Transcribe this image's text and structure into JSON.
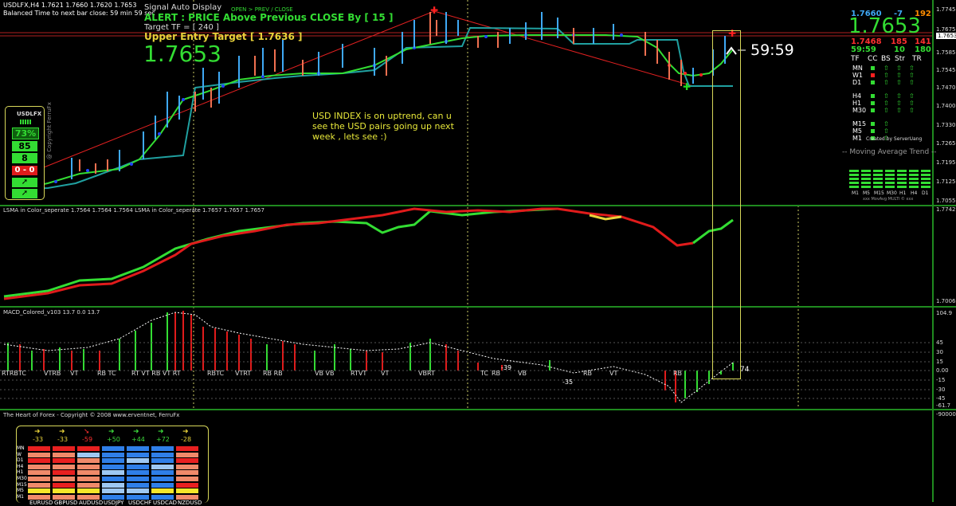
{
  "symbol_header": {
    "line1": "USDLFX,H4  1.7621 1.7660 1.7620 1.7653",
    "line2": "Balanced Time to next bar close: 59 min 59 sec"
  },
  "signal": {
    "title": "Signal Auto Display",
    "subtitle": "OPEN > PREV / CLOSE",
    "alert": "ALERT : PRICE Above Previous CLOSE By [ 15 ]",
    "target_tf": "Target TF = [ 240 ]",
    "upper_entry": "Upper Entry Target [ 1.7636 ]",
    "price": "1.7653"
  },
  "annotation": "USD INDEX is on uptrend, can u see the USD pairs going up next week , lets see :)",
  "countdown": "59:59",
  "left_widget": {
    "title": "USDLFX",
    "percent": "73%",
    "strength": "85",
    "count": "8",
    "range": "0 - 0",
    "vertical_label": "@ Copyright FerruFx"
  },
  "panel_top_right": {
    "v1": "1.7660",
    "v2": "-7",
    "v3": "192",
    "big_price": "1.7653",
    "low": "1.7468",
    "low_pts": "185",
    "spread": "141",
    "timer": "59:59",
    "n1": "10",
    "n2": "180",
    "headers": [
      "TF",
      "CC",
      "BS",
      "Str",
      "TR"
    ],
    "rows": [
      "MN",
      "W1",
      "D1",
      "H4",
      "H1",
      "M30",
      "M15",
      "M5",
      "M1"
    ],
    "created_by": "Created by ServerUang",
    "ma_trend": "-- Moving Average Trend --",
    "ma_tf": [
      "M1",
      "M5",
      "M15",
      "M30",
      "H1",
      "H4",
      "D1"
    ],
    "ma_footer": "xxx MovAvg MULTI © xxx"
  },
  "price_axis": [
    "1.7745",
    "1.7675",
    "1.7653",
    "1.7585",
    "1.7545",
    "1.7505",
    "1.7470",
    "1.7400",
    "1.7330",
    "1.7265",
    "1.7195",
    "1.7125",
    "1.7055"
  ],
  "price_axis_current": "1.7653",
  "lsma": {
    "label": "LSMA in Color_seperate 1.7564 1.7564 1.7564  LSMA in Color_seperate 1.7657 1.7657 1.7657",
    "axis_top": "1.7742",
    "axis_bottom": "1.7006"
  },
  "macd": {
    "label": "MACD_Colored_v103 13.7 0.0 13.7",
    "axis": [
      "104.9",
      "45",
      "30",
      "15",
      "0.00",
      "-15",
      "-30",
      "-45",
      "-61.7"
    ],
    "value_tag": "74",
    "neg_tags": [
      "-39",
      "-35"
    ],
    "pattern_labels": [
      "RTRBTC",
      "VTRB",
      "VT",
      "RB TC",
      "RT VT RB VT RT",
      "RBTC",
      "VTRT",
      "RB RB",
      "VB VB",
      "RTVT",
      "VT",
      "VBRT",
      "TC",
      "RB",
      "VB",
      "RB",
      "VT",
      "RB"
    ]
  },
  "heart": {
    "label": "The Heart of Forex - Copyright © 2008 www.erventnet, FerruFx",
    "axis_top": "-900000",
    "deltas": [
      "-33",
      "-33",
      "-59",
      "+50",
      "+44",
      "+72",
      "-28"
    ],
    "delta_colors": [
      "#e8d23a",
      "#e8d23a",
      "#ff3030",
      "#3cd83c",
      "#3cd83c",
      "#3cd83c",
      "#e8d23a"
    ],
    "rows": [
      "MN",
      "W",
      "D1",
      "H4",
      "H1",
      "M30",
      "M15",
      "M5",
      "M1"
    ],
    "pairs": [
      "EURUSD",
      "GBPUSD",
      "AUDUSD",
      "USDJPY",
      "USDCHF",
      "USDCAD",
      "NZDUSD"
    ]
  }
}
